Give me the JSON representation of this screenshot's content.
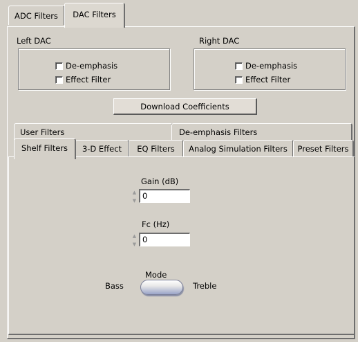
{
  "top_tabs": [
    {
      "label": "ADC Filters",
      "active": false
    },
    {
      "label": "DAC Filters",
      "active": true
    }
  ],
  "left_dac": {
    "title": "Left DAC",
    "checkboxes": [
      {
        "label": "De-emphasis",
        "checked": false
      },
      {
        "label": "Effect Filter",
        "checked": false
      }
    ]
  },
  "right_dac": {
    "title": "Right DAC",
    "checkboxes": [
      {
        "label": "De-emphasis",
        "checked": false
      },
      {
        "label": "Effect Filter",
        "checked": false
      }
    ]
  },
  "download_button": "Download Coefficients",
  "filter_tabs_row1": [
    {
      "label": "User Filters"
    },
    {
      "label": "De-emphasis Filters"
    }
  ],
  "filter_tabs_row2": [
    {
      "label": "Shelf Filters",
      "active": true
    },
    {
      "label": "3-D Effect"
    },
    {
      "label": "EQ Filters"
    },
    {
      "label": "Analog Simulation Filters"
    },
    {
      "label": "Preset Filters"
    }
  ],
  "shelf": {
    "gain_label": "Gain (dB)",
    "gain_value": "0",
    "fc_label": "Fc (Hz)",
    "fc_value": "0",
    "mode_label": "Mode",
    "mode_left": "Bass",
    "mode_right": "Treble",
    "mode_selected": "Bass"
  },
  "icons": {
    "checkbox": "checkbox-icon",
    "spin_up": "spin-up-icon",
    "spin_down": "spin-down-icon"
  }
}
